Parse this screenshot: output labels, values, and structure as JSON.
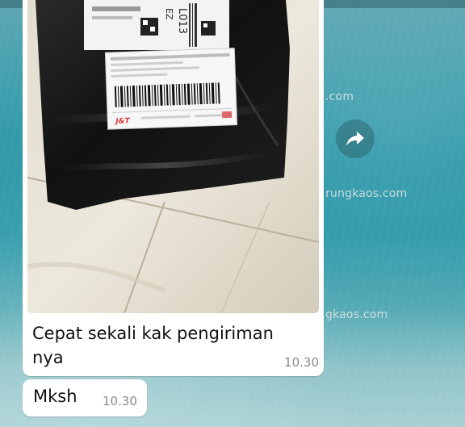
{
  "watermarks": [
    ".com",
    "rungkaos.com",
    "gkaos.com",
    ".com"
  ],
  "messages": [
    {
      "type": "image",
      "image_description_icon": "package-photo",
      "caption": "Cepat sekali kak pengiriman nya",
      "time": "10.30"
    },
    {
      "type": "text",
      "text": "Mksh",
      "time": "10.30"
    }
  ],
  "package_label": {
    "code_fragment": "L013",
    "code_fragment_2": "EZ",
    "courier_logo": "J&T"
  },
  "icons": {
    "forward": "forward-share-icon"
  },
  "colors": {
    "bubble": "#ffffff",
    "time": "#8a8a8a",
    "wallpaper": "#2b98a9"
  }
}
